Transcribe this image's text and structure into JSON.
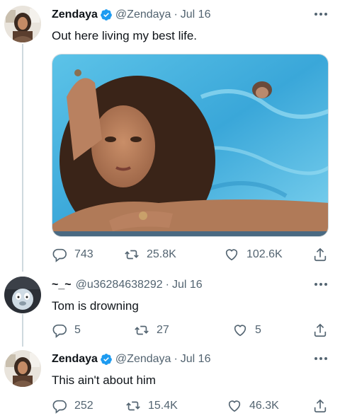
{
  "tweets": [
    {
      "name": "Zendaya",
      "handle": "@Zendaya",
      "date": "Jul 16",
      "text": "Out here living my best life.",
      "replies": "743",
      "retweets": "25.8K",
      "likes": "102.6K",
      "verified": true
    },
    {
      "name": "~_~",
      "handle": "@u36284638292",
      "date": "Jul 16",
      "text": "Tom is drowning",
      "replies": "5",
      "retweets": "27",
      "likes": "5",
      "verified": false
    },
    {
      "name": "Zendaya",
      "handle": "@Zendaya",
      "date": "Jul 16",
      "text": "This ain't about him",
      "replies": "252",
      "retweets": "15.4K",
      "likes": "46.3K",
      "verified": true
    }
  ],
  "separator": "·",
  "colors": {
    "verified_blue": "#1d9bf0",
    "muted_text": "#536471",
    "thread_line": "#cfd9de"
  },
  "icons": [
    "reply-icon",
    "retweet-icon",
    "like-icon",
    "share-icon",
    "more-icon",
    "verified-icon"
  ]
}
